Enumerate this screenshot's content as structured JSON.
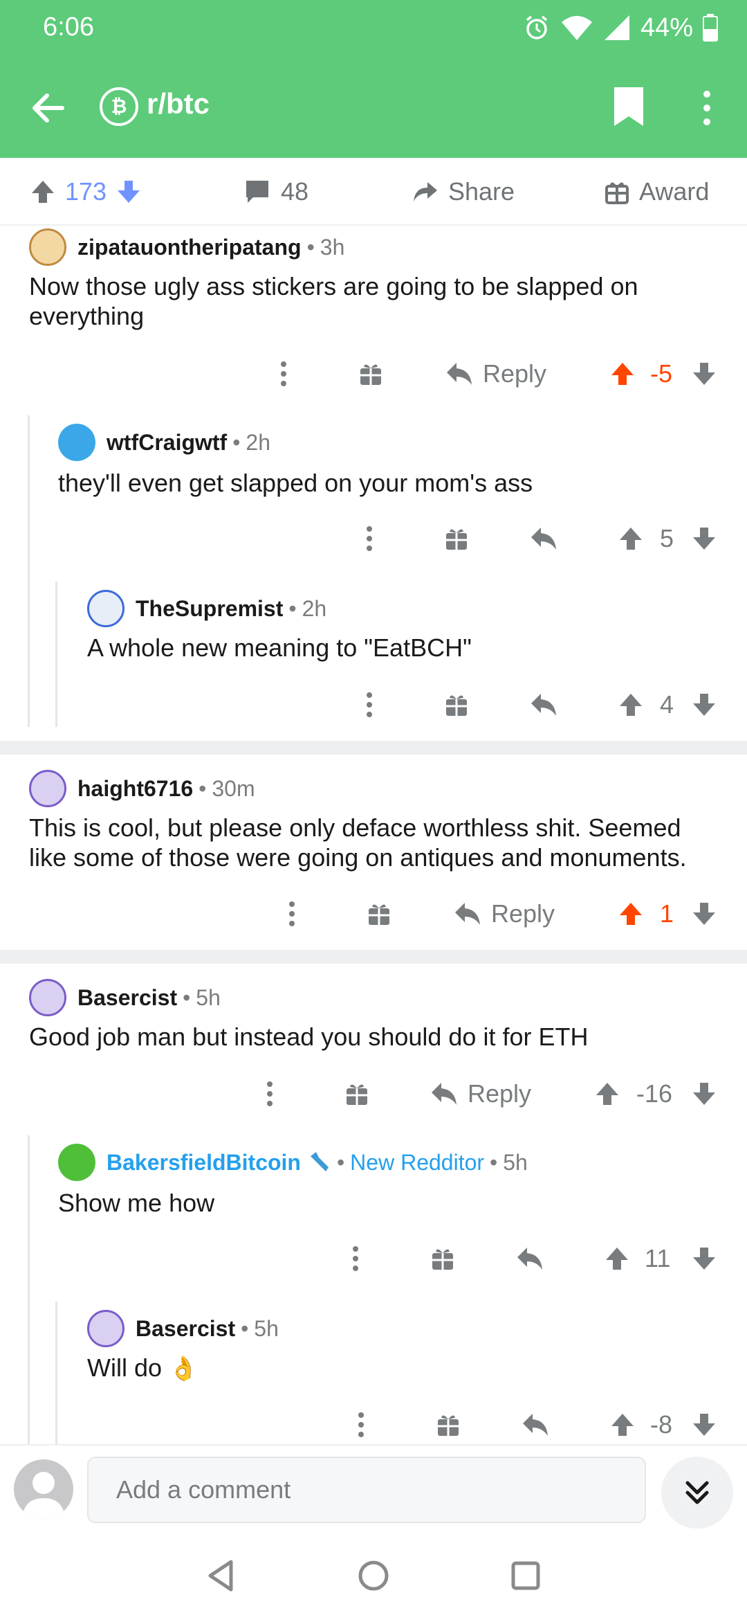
{
  "status": {
    "time": "6:06",
    "battery": "44%"
  },
  "toolbar": {
    "subreddit": "r/btc",
    "subreddit_icon": "bitcoin-icon"
  },
  "post_actions": {
    "score": "173",
    "comments": "48",
    "share": "Share",
    "award": "Award"
  },
  "colors": {
    "header": "#5dcb7a",
    "upvote": "#ff4500",
    "score_blue": "#7193ff",
    "user_blue": "#24a0ed"
  },
  "comments": [
    {
      "user": "zipatauontheripatang",
      "time": "3h",
      "body": "Now those ugly ass stickers are going to be slapped on everything",
      "reply": "Reply",
      "score": "-5",
      "upvoted": true
    },
    {
      "user": "wtfCraigwtf",
      "time": "2h",
      "body": "they'll even get slapped on your mom's ass",
      "score": "5"
    },
    {
      "user": "TheSupremist",
      "time": "2h",
      "body": "A whole new meaning to \"EatBCH\"",
      "score": "4"
    },
    {
      "user": "haight6716",
      "time": "30m",
      "body": "This is cool, but please only deface worthless shit. Seemed like some of those were going on antiques and monuments.",
      "reply": "Reply",
      "score": "1",
      "upvoted": true
    },
    {
      "user": "Basercist",
      "time": "5h",
      "body": "Good job man but instead you should do it for ETH",
      "reply": "Reply",
      "score": "-16"
    },
    {
      "user": "BakersfieldBitcoin",
      "flair": "New Redditor",
      "time": "5h",
      "body": "Show me how",
      "score": "11"
    },
    {
      "user": "Basercist",
      "time": "5h",
      "body": "Will do",
      "emoji": "👌",
      "score": "-8"
    }
  ],
  "comment_bar": {
    "placeholder": "Add a comment"
  }
}
